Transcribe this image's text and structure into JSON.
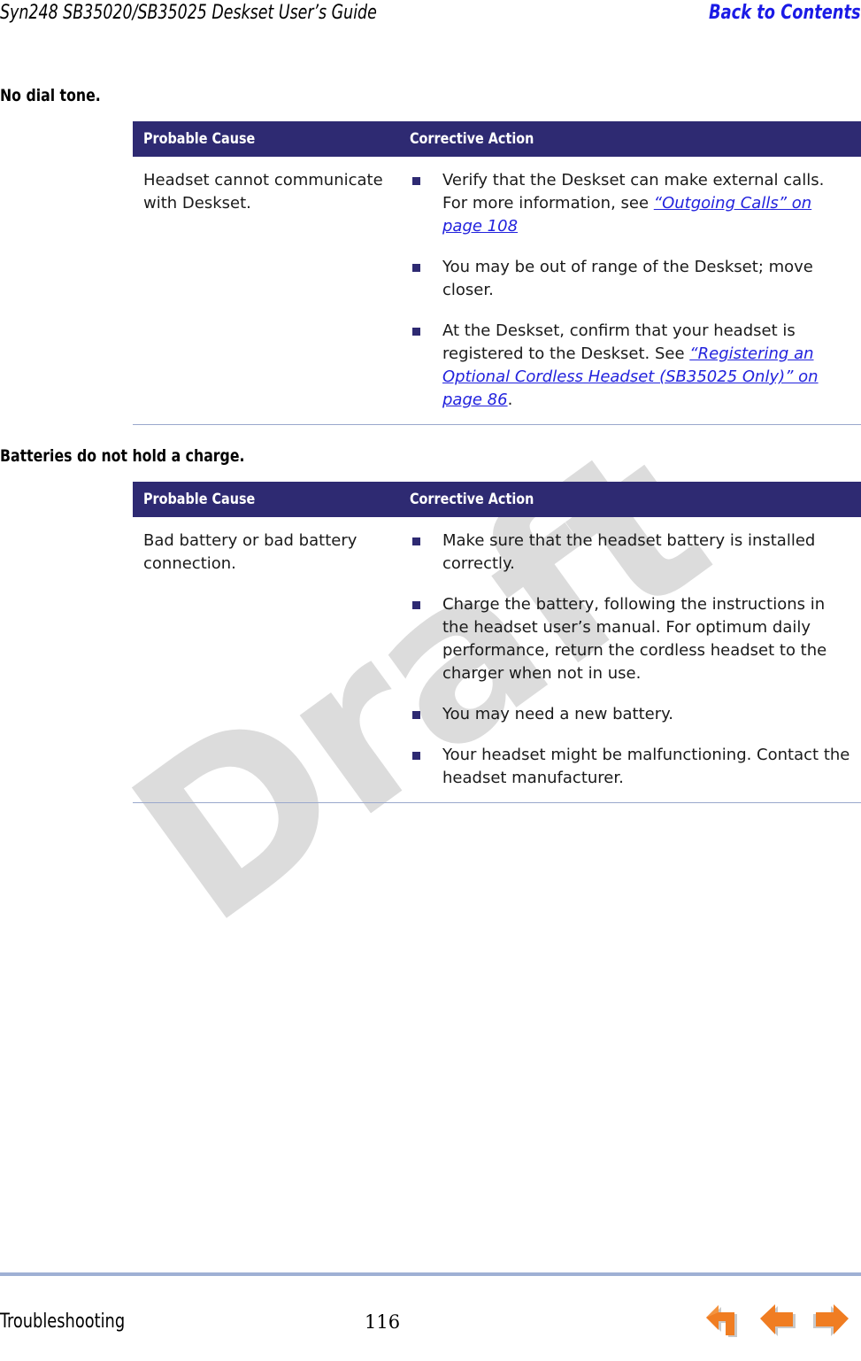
{
  "header": {
    "title": "Syn248 SB35020/SB35025 Deskset User’s Guide",
    "back_link": "Back to Contents"
  },
  "watermark": {
    "text": "Draft"
  },
  "table_columns": {
    "probable_cause": "Probable Cause",
    "corrective_action": "Corrective Action"
  },
  "sections": [
    {
      "title": "No dial tone.",
      "cause": "Headset cannot communicate with Deskset.",
      "actions": [
        {
          "lead": "Verify that the Deskset can make external calls. For more information, see ",
          "xref": "“Outgoing Calls” on page 108",
          "tail": ""
        },
        {
          "lead": "You may be out of range of the Deskset; move closer.",
          "xref": "",
          "tail": ""
        },
        {
          "lead": "At the Deskset, confirm that your headset is registered to the Deskset. See ",
          "xref": "“Registering an Optional Cordless Headset (SB35025 Only)” on page 86",
          "tail": "."
        }
      ]
    },
    {
      "title": "Batteries do not hold a charge.",
      "cause": "Bad battery or bad battery connection.",
      "actions": [
        {
          "lead": "Make sure that the headset battery is installed correctly.",
          "xref": "",
          "tail": ""
        },
        {
          "lead": "Charge the battery, following the instructions in the headset user’s manual. For optimum daily performance, return the cordless headset to the charger when not in use.",
          "xref": "",
          "tail": ""
        },
        {
          "lead": "You may need a new battery.",
          "xref": "",
          "tail": ""
        },
        {
          "lead": "Your headset might be malfunctioning. Contact the headset manufacturer.",
          "xref": "",
          "tail": ""
        }
      ]
    }
  ],
  "footer": {
    "chapter": "Troubleshooting",
    "page_number": "116",
    "nav": [
      {
        "name": "back-arrow-icon",
        "title": "Back"
      },
      {
        "name": "previous-page-arrow-icon",
        "title": "Previous"
      },
      {
        "name": "next-page-arrow-icon",
        "title": "Next"
      }
    ]
  },
  "colors": {
    "table_header_bg": "#2e2a72",
    "bullet": "#2e2a72",
    "xref_link": "#2222dd",
    "header_link": "#1a1ae6",
    "rule": "#9fb0d4",
    "watermark": "#dcdcdc",
    "arrow_orange": "#f07d22",
    "arrow_gray": "#b9b9b9"
  }
}
